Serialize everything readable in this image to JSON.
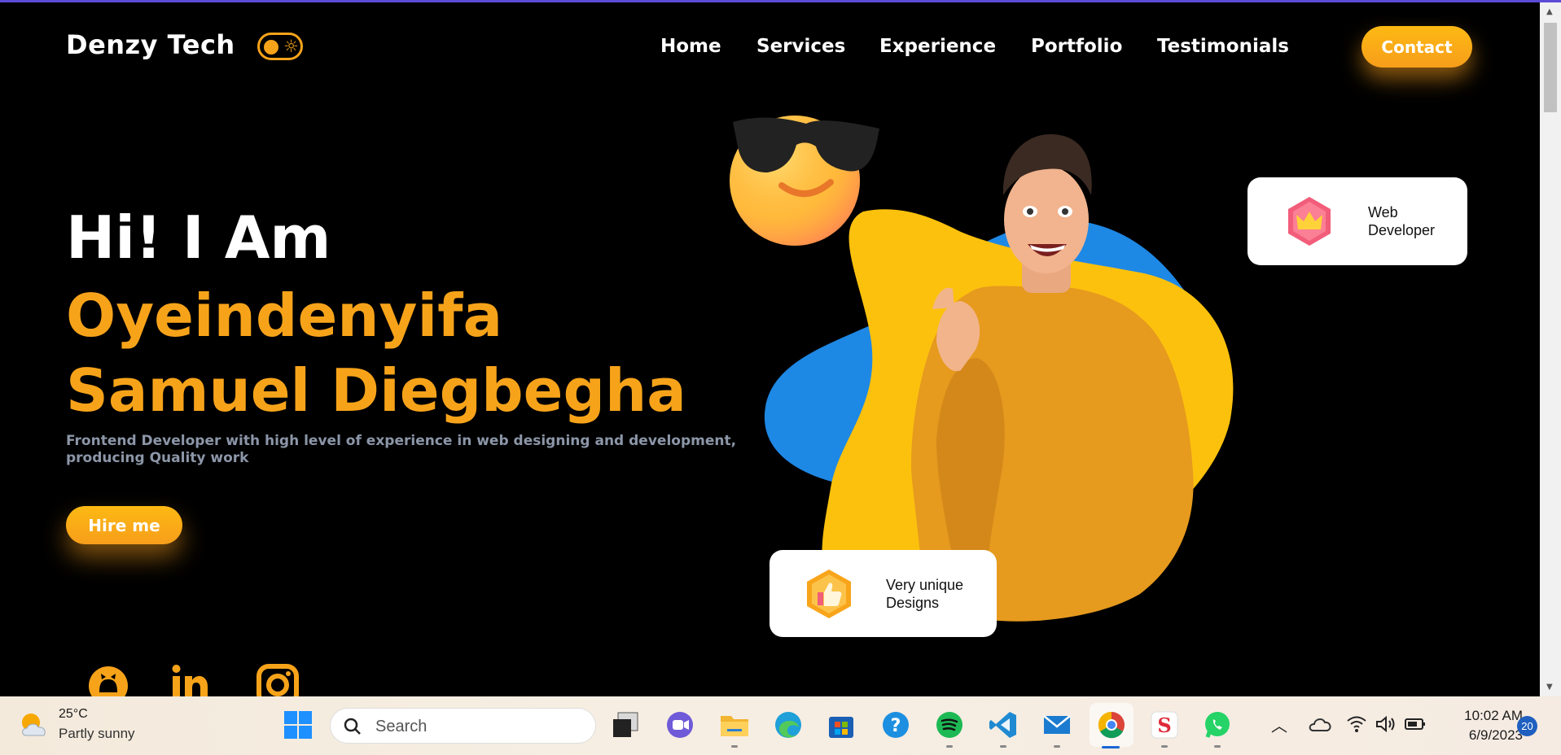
{
  "header": {
    "brand": "Denzy Tech",
    "nav": [
      "Home",
      "Services",
      "Experience",
      "Portfolio",
      "Testimonials"
    ],
    "contact_label": "Contact",
    "theme_toggle_icon": "sun-icon"
  },
  "hero": {
    "greeting": "Hi! I Am",
    "name": "Oyeindenyifa Samuel Diegbegha",
    "description": "Frontend Developer with high level of experience in web designing and development, producing Quality work",
    "hire_label": "Hire me",
    "social_icons": [
      "github-icon",
      "linkedin-icon",
      "instagram-icon"
    ]
  },
  "cards": {
    "web_dev": "Web Developer",
    "designs": "Very unique Designs"
  },
  "colors": {
    "accent": "#f7a31a",
    "blob_yellow": "#fcc10d",
    "blob_blue": "#1e88e5"
  },
  "taskbar": {
    "temperature": "25°C",
    "weather": "Partly sunny",
    "search_placeholder": "Search",
    "time": "10:02 AM",
    "date": "6/9/2023",
    "notifications": "20"
  }
}
